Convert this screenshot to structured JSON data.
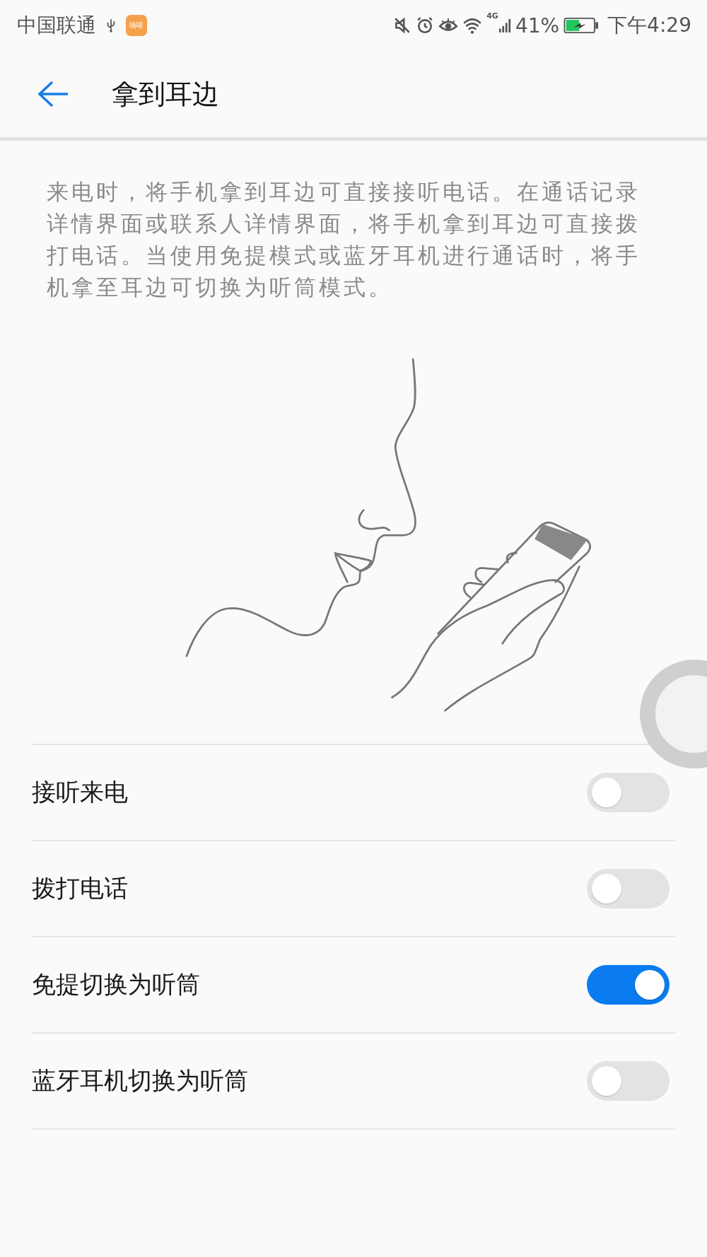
{
  "status_bar": {
    "carrier": "中国联通",
    "app_icon_label": "嘀嗒",
    "network": "4G",
    "battery_percent": "41%",
    "time": "下午4:29"
  },
  "header": {
    "title": "拿到耳边"
  },
  "description": "来电时，将手机拿到耳边可直接接听电话。在通话记录详情界面或联系人详情界面，将手机拿到耳边可直接拨打电话。当使用免提模式或蓝牙耳机进行通话时，将手机拿至耳边可切换为听筒模式。",
  "settings": [
    {
      "label": "接听来电",
      "on": false
    },
    {
      "label": "拨打电话",
      "on": false
    },
    {
      "label": "免提切换为听筒",
      "on": true
    },
    {
      "label": "蓝牙耳机切换为听筒",
      "on": false
    }
  ]
}
